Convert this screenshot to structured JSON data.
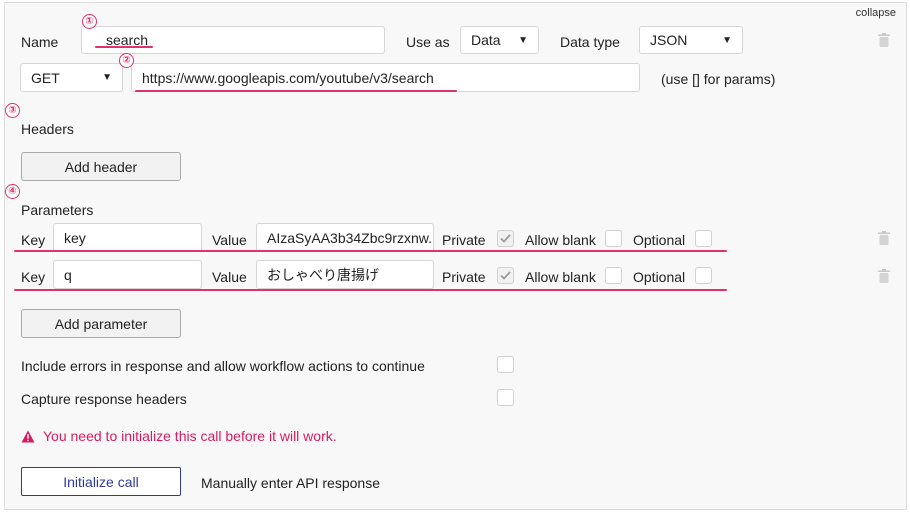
{
  "collapse_label": "collapse",
  "call": {
    "name_label": "Name",
    "name_value": "search",
    "use_as_label": "Use as",
    "use_as_value": "Data",
    "data_type_label": "Data type",
    "data_type_value": "JSON",
    "method_value": "GET",
    "url_value": "https://www.googleapis.com/youtube/v3/search",
    "url_hint": "(use [] for params)"
  },
  "annotations": [
    "①",
    "②",
    "③",
    "④"
  ],
  "headers": {
    "label": "Headers",
    "add_button": "Add header"
  },
  "parameters": {
    "label": "Parameters",
    "key_label": "Key",
    "value_label": "Value",
    "private_label": "Private",
    "allow_blank_label": "Allow blank",
    "optional_label": "Optional",
    "rows": [
      {
        "key": "key",
        "value": "AIzaSyAA3b34Zbc9rzxnw...",
        "private": true,
        "allow_blank": false,
        "optional": false
      },
      {
        "key": "q",
        "value": "おしゃべり唐揚げ",
        "private": true,
        "allow_blank": false,
        "optional": false
      }
    ],
    "add_button": "Add parameter"
  },
  "options": {
    "include_errors_label": "Include errors in response and allow workflow actions to continue",
    "capture_headers_label": "Capture response headers"
  },
  "warning_text": "You need to initialize this call before it will work.",
  "initialize_button": "Initialize call",
  "manual_link": "Manually enter API response",
  "colors": {
    "accent_pink": "#e0306f",
    "warning_red": "#d81b60",
    "primary_blue": "#2f3b9c"
  }
}
